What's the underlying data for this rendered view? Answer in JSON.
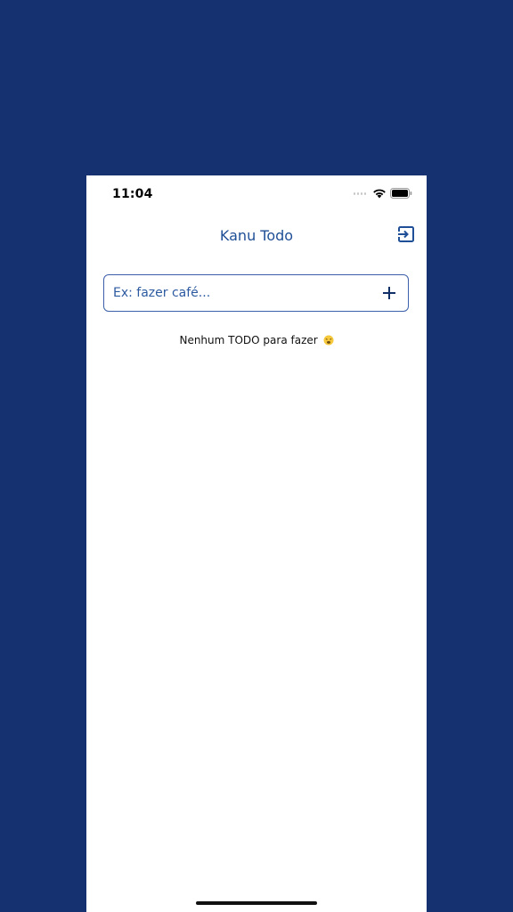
{
  "status_bar": {
    "time": "11:04"
  },
  "header": {
    "title": "Kanu Todo",
    "logout_icon": "logout-icon"
  },
  "todo_input": {
    "placeholder": "Ex: fazer café...",
    "value": "",
    "add_icon": "plus-icon"
  },
  "empty_state": {
    "message": "Nenhum TODO para fazer",
    "emoji_icon": "weary-face-emoji"
  },
  "colors": {
    "background": "#163170",
    "accent": "#1f4f96",
    "surface": "#ffffff"
  }
}
